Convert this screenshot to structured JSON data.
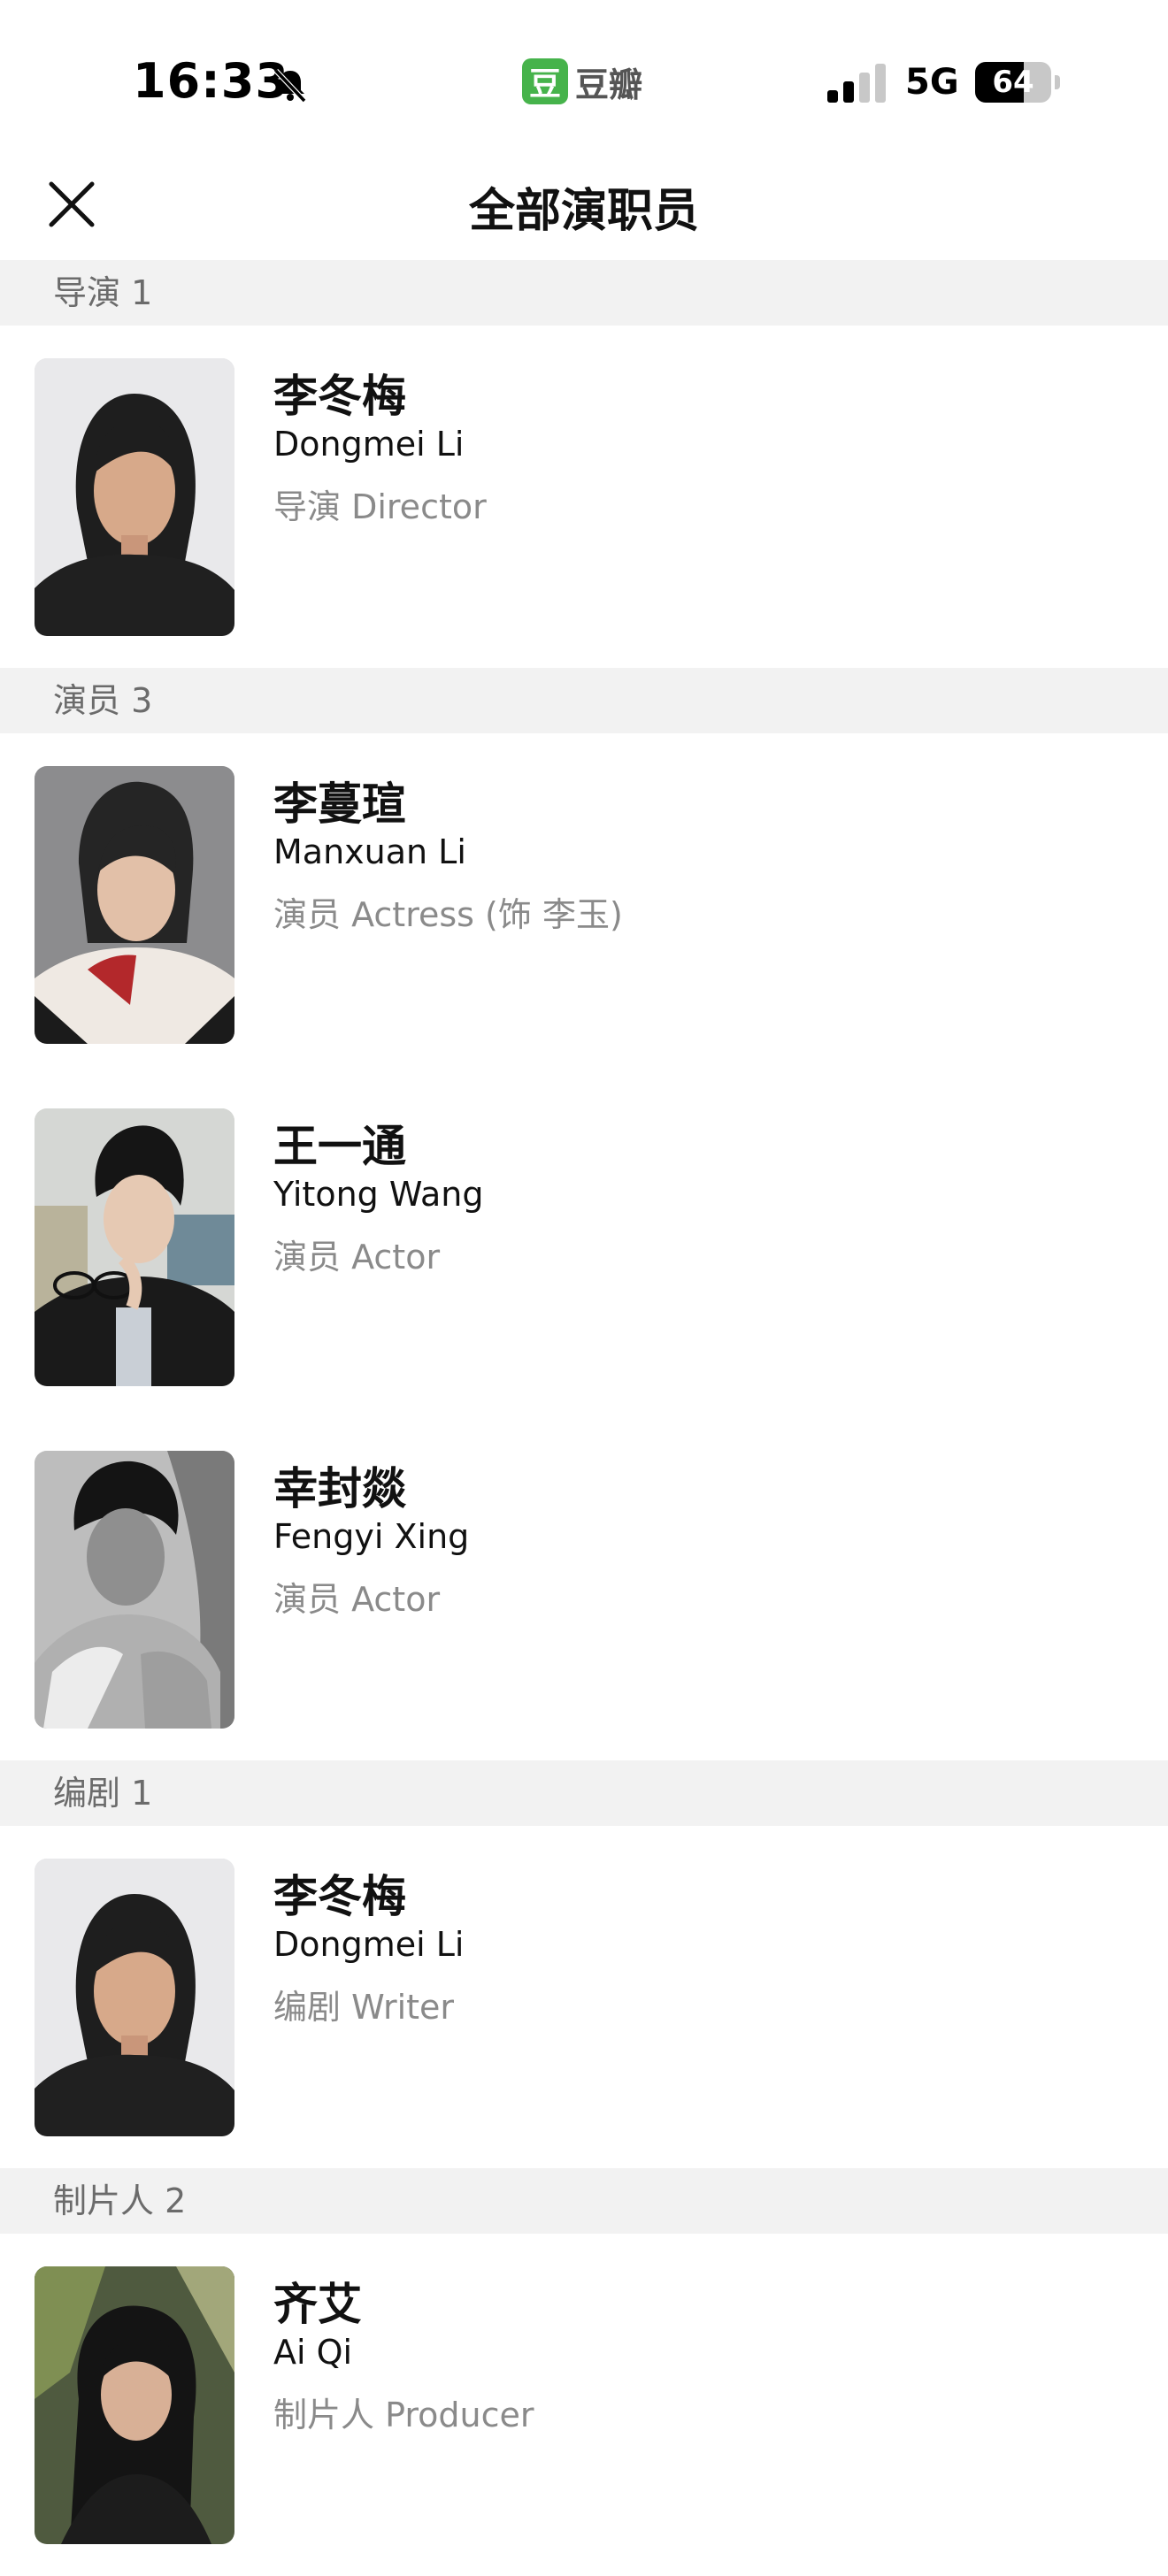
{
  "status_bar": {
    "time": "16:33",
    "app_name": "豆瓣",
    "app_icon_glyph": "豆",
    "network": "5G",
    "battery_level": "64",
    "battery_fraction": 0.64
  },
  "nav": {
    "title": "全部演职员",
    "close_icon": "close-icon"
  },
  "sections": {
    "director": {
      "header": "导演 1"
    },
    "cast": {
      "header": "演员 3"
    },
    "writer": {
      "header": "编剧 1"
    },
    "producer": {
      "header": "制片人 2"
    }
  },
  "people": {
    "director_0": {
      "name_zh": "李冬梅",
      "name_en": "Dongmei Li",
      "role": "导演 Director"
    },
    "cast_0": {
      "name_zh": "李蔓瑄",
      "name_en": "Manxuan Li",
      "role": "演员 Actress (饰 李玉)"
    },
    "cast_1": {
      "name_zh": "王一通",
      "name_en": "Yitong Wang",
      "role": "演员 Actor"
    },
    "cast_2": {
      "name_zh": "幸封燚",
      "name_en": "Fengyi Xing",
      "role": "演员 Actor"
    },
    "writer_0": {
      "name_zh": "李冬梅",
      "name_en": "Dongmei Li",
      "role": "编剧 Writer"
    },
    "producer_0": {
      "name_zh": "齐艾",
      "name_en": "Ai Qi",
      "role": "制片人 Producer"
    }
  },
  "colors": {
    "section_bg": "#f2f2f2",
    "secondary_text": "#8a8a8a",
    "app_green": "#46b34b"
  }
}
